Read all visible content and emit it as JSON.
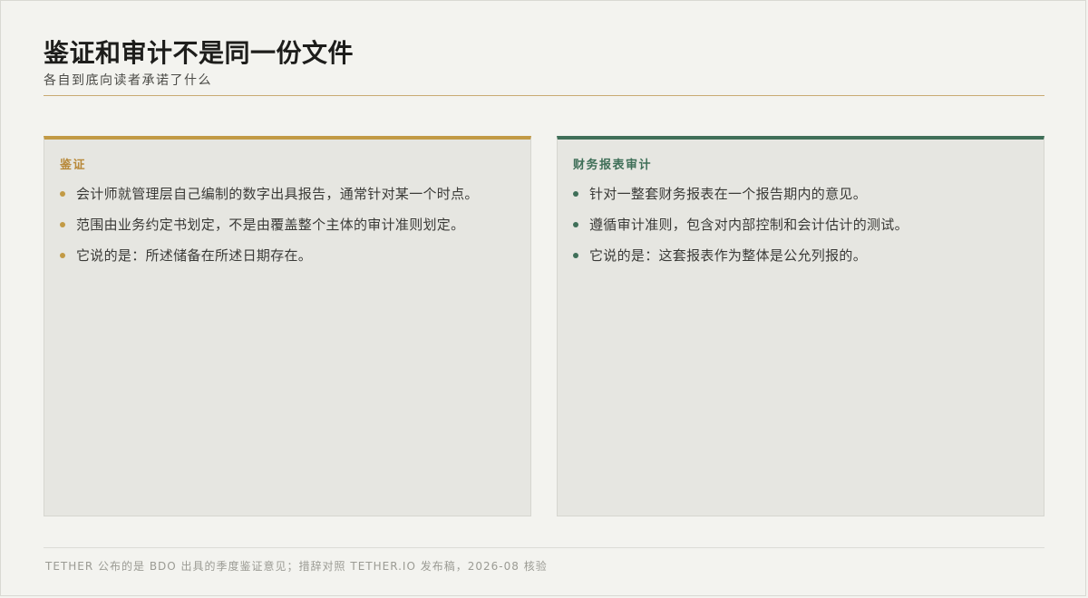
{
  "header": {
    "title": "鉴证和审计不是同一份文件",
    "subtitle": "各自到底向读者承诺了什么"
  },
  "panels": [
    {
      "label": "鉴证",
      "accent": "#c29a45",
      "items": [
        "会计师就管理层自己编制的数字出具报告，通常针对某一个时点。",
        "范围由业务约定书划定，不是由覆盖整个主体的审计准则划定。",
        "它说的是：所述储备在所述日期存在。"
      ]
    },
    {
      "label": "财务报表审计",
      "accent": "#3f6f58",
      "items": [
        "针对一整套财务报表在一个报告期内的意见。",
        "遵循审计准则，包含对内部控制和会计估计的测试。",
        "它说的是：这套报表作为整体是公允列报的。"
      ]
    }
  ],
  "footer": {
    "note": "TETHER 公布的是 BDO 出具的季度鉴证意见；措辞对照 TETHER.IO 发布稿，2026-08 核验"
  }
}
